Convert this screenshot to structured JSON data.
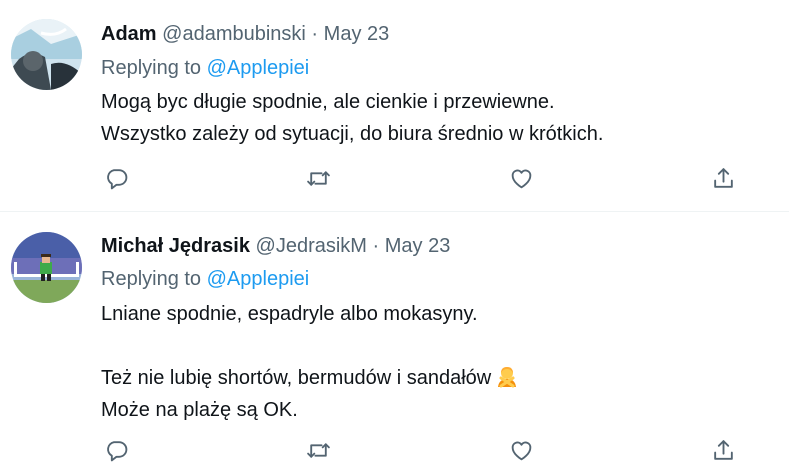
{
  "tweets": [
    {
      "name": "Adam",
      "handle": "@adambubinski",
      "separator": "·",
      "date": "May 23",
      "replying_prefix": "Replying to ",
      "replying_to": "@Applepiei",
      "lines": [
        "Mogą byc długie spodnie, ale cienkie i przewiewne.",
        "Wszystko zależy od sytuacji, do biura średnio w krótkich."
      ]
    },
    {
      "name": "Michał Jędrasik",
      "handle": "@JedrasikM",
      "separator": "·",
      "date": "May 23",
      "replying_prefix": "Replying to ",
      "replying_to": "@Applepiei",
      "lines": [
        "Lniane spodnie, espadryle albo mokasyny.",
        "",
        "Też nie lubię shortów, bermudów i sandałów",
        "Może na plażę są OK."
      ],
      "emoji": "person-gesturing-no-emoji"
    }
  ],
  "colors": {
    "text": "#0f1419",
    "secondary": "#536471",
    "link": "#1d9bf0",
    "divider": "#eff3f4"
  },
  "icons": [
    "reply-icon",
    "retweet-icon",
    "like-icon",
    "share-icon"
  ]
}
